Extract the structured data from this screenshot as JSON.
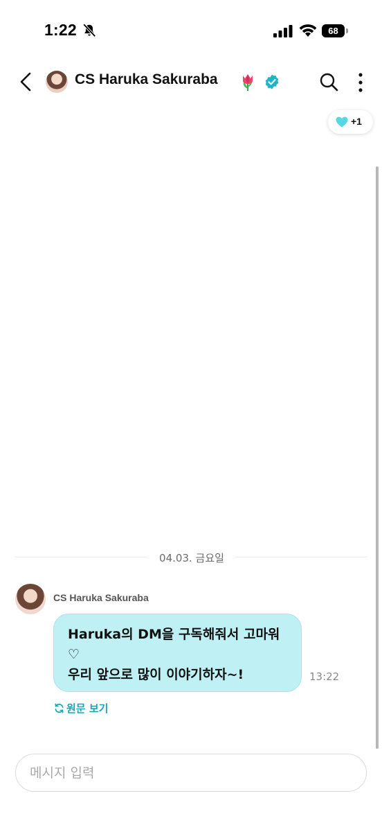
{
  "status_bar": {
    "time": "1:22",
    "battery": "68",
    "icons": [
      "bell-slash-icon",
      "signal-icon",
      "wifi-icon",
      "battery-icon"
    ]
  },
  "header": {
    "title": "CS Haruka Sakuraba",
    "icons": [
      "back-icon",
      "tulip-icon",
      "verified-icon",
      "search-icon",
      "more-icon"
    ]
  },
  "reaction": {
    "icon": "heart-icon",
    "count": "+1"
  },
  "chat": {
    "date_divider": "04.03. 금요일",
    "messages": [
      {
        "sender": "CS Haruka Sakuraba",
        "lines": [
          "Haruka의 DM을 구독해줘서 고마워",
          "♡",
          "우리 앞으로 많이 이야기하자~!"
        ],
        "time": "13:22",
        "original_link": "원문 보기"
      }
    ]
  },
  "composer": {
    "placeholder": "메시지 입력",
    "value": ""
  },
  "colors": {
    "bubble": "#bef0f4",
    "accent": "#19a7b4",
    "verified": "#1fb6c4"
  }
}
